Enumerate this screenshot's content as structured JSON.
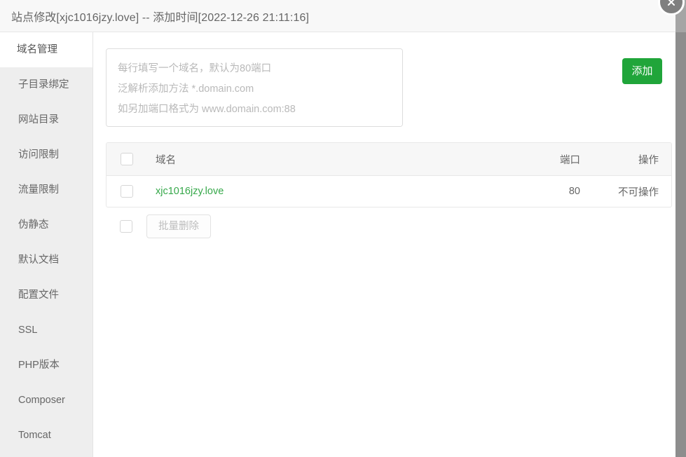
{
  "window": {
    "title": "站点修改[xjc1016jzy.love] -- 添加时间[2022-12-26 21:11:16]",
    "close_icon": "close-icon"
  },
  "sidebar": {
    "items": [
      {
        "label": "域名管理",
        "active": true
      },
      {
        "label": "子目录绑定",
        "active": false
      },
      {
        "label": "网站目录",
        "active": false
      },
      {
        "label": "访问限制",
        "active": false
      },
      {
        "label": "流量限制",
        "active": false
      },
      {
        "label": "伪静态",
        "active": false
      },
      {
        "label": "默认文档",
        "active": false
      },
      {
        "label": "配置文件",
        "active": false
      },
      {
        "label": "SSL",
        "active": false
      },
      {
        "label": "PHP版本",
        "active": false
      },
      {
        "label": "Composer",
        "active": false
      },
      {
        "label": "Tomcat",
        "active": false
      }
    ]
  },
  "add_panel": {
    "textarea_value": "",
    "textarea_placeholder": "每行填写一个域名，默认为80端口\n泛解析添加方法 *.domain.com\n如另加端口格式为 www.domain.com:88",
    "add_button_label": "添加",
    "add_button_color": "#20a53a"
  },
  "table": {
    "headers": {
      "domain": "域名",
      "port": "端口",
      "operation": "操作"
    },
    "rows": [
      {
        "domain": "xjc1016jzy.love",
        "port": "80",
        "operation": "不可操作"
      }
    ]
  },
  "bulk": {
    "delete_label": "批量删除"
  }
}
